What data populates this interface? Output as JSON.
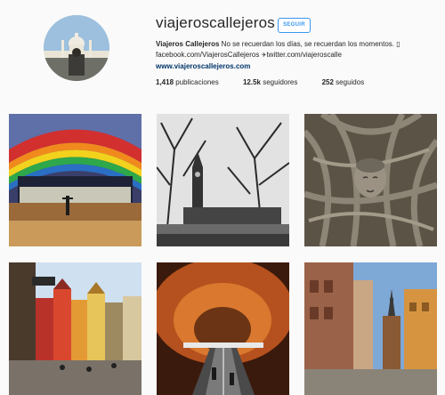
{
  "profile": {
    "username": "viajeroscallejeros",
    "follow_label": "SEGUIR",
    "full_name": "Viajeros Callejeros",
    "bio_text": " No se recuerdan los días, se recuerdan los momentos. ",
    "bio_line2": "facebook.com/ViajerosCallejeros ",
    "bio_line2b": "twitter.com/viajeroscalle",
    "website": "www.viajeroscallejeros.com"
  },
  "stats": {
    "posts_count": "1,418",
    "posts_label": " publicaciones",
    "followers_count": "12.5k",
    "followers_label": " seguidores",
    "following_count": "252",
    "following_label": " seguidos"
  },
  "posts": [
    {
      "subject": "rainbow-cave-metro-station"
    },
    {
      "subject": "big-ben-black-and-white"
    },
    {
      "subject": "buddha-head-in-tree-roots"
    },
    {
      "subject": "colorful-old-town-square"
    },
    {
      "subject": "cave-metro-escalators"
    },
    {
      "subject": "european-street-with-church-spire"
    }
  ]
}
